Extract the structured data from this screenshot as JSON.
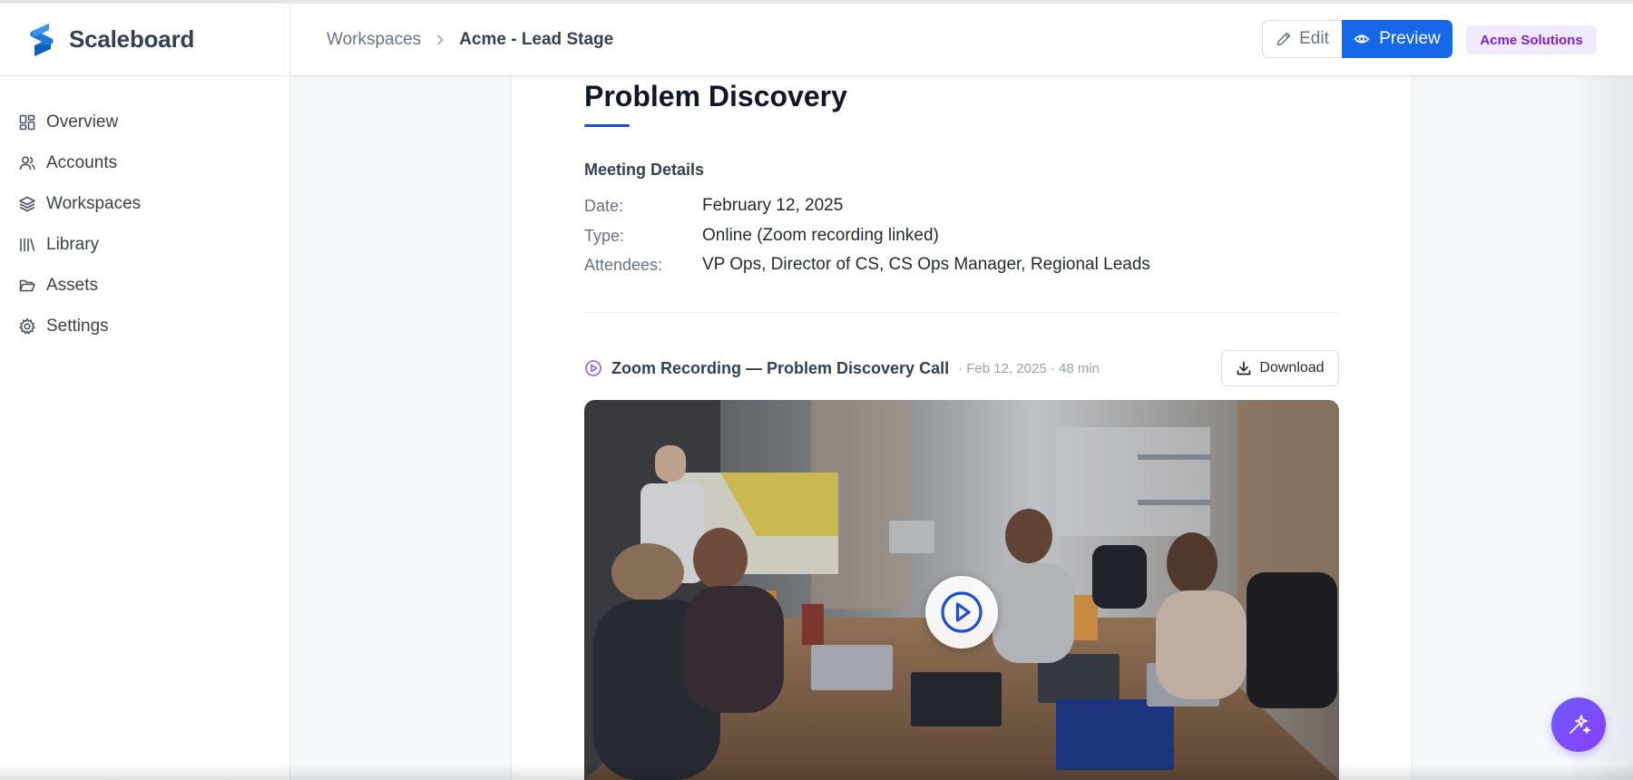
{
  "app": {
    "brand_name": "Scaleboard",
    "accent_color": "#1668e8"
  },
  "sidebar": {
    "items": [
      {
        "label": "Overview",
        "icon": "grid-icon"
      },
      {
        "label": "Accounts",
        "icon": "users-icon"
      },
      {
        "label": "Workspaces",
        "icon": "layers-icon"
      },
      {
        "label": "Library",
        "icon": "library-icon"
      },
      {
        "label": "Assets",
        "icon": "folder-icon"
      },
      {
        "label": "Settings",
        "icon": "gear-icon"
      }
    ]
  },
  "header": {
    "breadcrumb": {
      "parent": "Workspaces",
      "current": "Acme - Lead Stage"
    },
    "edit_label": "Edit",
    "preview_label": "Preview",
    "org_badge": "Acme Solutions"
  },
  "page": {
    "title": "Problem Discovery",
    "meeting_details": {
      "heading": "Meeting Details",
      "rows": [
        {
          "label": "Date:",
          "value": "February 12, 2025"
        },
        {
          "label": "Type:",
          "value": "Online (Zoom recording linked)"
        },
        {
          "label": "Attendees:",
          "value": "VP Ops, Director of CS, CS Ops Manager, Regional Leads"
        }
      ]
    },
    "recording": {
      "title": "Zoom Recording — Problem Discovery Call",
      "meta": "· Feb 12, 2025 · 48 min",
      "download_label": "Download"
    }
  }
}
